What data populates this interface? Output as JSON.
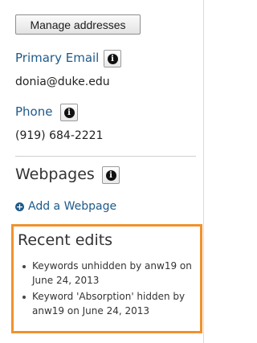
{
  "manage_addresses_label": "Manage addresses",
  "primary_email": {
    "label": "Primary Email",
    "info_glyph": "i",
    "value": "donia@duke.edu"
  },
  "phone": {
    "label": "Phone",
    "info_glyph": "i",
    "value": "(919) 684-2221"
  },
  "webpages": {
    "heading": "Webpages",
    "info_glyph": "i",
    "add_label": "Add a Webpage",
    "add_icon_glyph": "+"
  },
  "recent_edits": {
    "heading": "Recent edits",
    "items": [
      "Keywords unhidden by anw19 on June 24, 2013",
      "Keyword 'Absorption' hidden by anw19 on June 24, 2013"
    ]
  },
  "colors": {
    "link": "#1d5a8a",
    "highlight_border": "#f0922e"
  }
}
